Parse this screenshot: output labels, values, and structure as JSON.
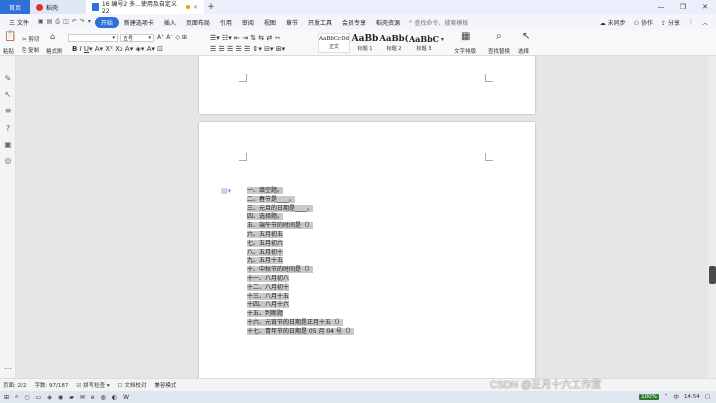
{
  "tabs": {
    "home": "首页",
    "docer": "稻壳",
    "document": "16 编号2 多...使用及自定义22"
  },
  "window_controls": [
    "—",
    "❐",
    "✕"
  ],
  "menu": {
    "file": "三 文件",
    "items": [
      "开始",
      "插入",
      "页面布局",
      "引用",
      "审阅",
      "视图",
      "章节",
      "开发工具",
      "会员专享",
      "稻壳资源"
    ],
    "extra": "新建选项卡",
    "search": "查找命令、搜索模板",
    "sync": "未同步",
    "collab": "协作",
    "share": "分享"
  },
  "ribbon": {
    "paste": "粘贴",
    "cut": "剪切",
    "copy": "复制",
    "format_painter": "格式刷",
    "font_size": "五号",
    "styles": [
      {
        "sample": "AaBbCcDd",
        "name": "正文"
      },
      {
        "sample": "AaBb",
        "name": "标题 1"
      },
      {
        "sample": "AaBb(",
        "name": "标题 2"
      },
      {
        "sample": "AaBbC",
        "name": "标题 3"
      }
    ],
    "text_layout": "文字排版",
    "find_replace": "查找替换",
    "select": "选择"
  },
  "document": {
    "items": [
      "一、填空题。",
      "二、春节是____。",
      "三、元旦的日期是____。",
      "四、选择题。",
      "五、端午节的时间是（）",
      "六、五月初五",
      "七、五月初六",
      "八、五月初十",
      "九、五月十五",
      "十、中秋节的时间是（）",
      "十一、八月初八",
      "十二、八月初十",
      "十三、八月十五",
      "十四、八月十六",
      "十五、判断题",
      "十六、元宵节的日期是正月十五（）",
      "十七、青年节的日期是 05 月 04 号（）"
    ]
  },
  "status": {
    "page": "页面: 2/2",
    "words": "字数: 97/187",
    "spell": "拼写检查",
    "proof": "文档校对",
    "compat": "兼容模式"
  },
  "taskbar": {
    "zoom": "100%",
    "lang": "中",
    "time": "14:54"
  },
  "watermark": "CSDN @正月十六工作室"
}
